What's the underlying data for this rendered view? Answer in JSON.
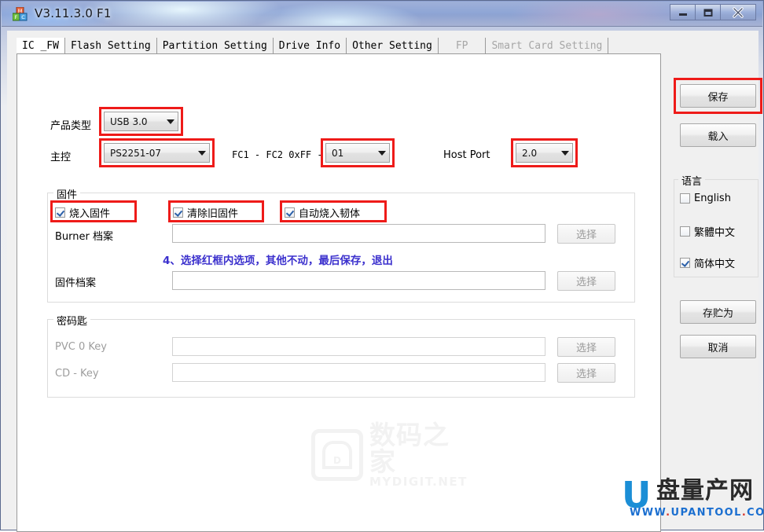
{
  "window": {
    "title": "V3.11.3.0 F1",
    "icon": "mfc-app-icon",
    "controls": {
      "minimize": "minimize-icon",
      "maximize": "maximize-icon",
      "close": "close-icon"
    }
  },
  "tabs": [
    {
      "label": "IC _FW",
      "active": true,
      "disabled": false
    },
    {
      "label": "Flash Setting",
      "active": false,
      "disabled": false
    },
    {
      "label": "Partition Setting",
      "active": false,
      "disabled": false
    },
    {
      "label": "Drive Info",
      "active": false,
      "disabled": false
    },
    {
      "label": "Other Setting",
      "active": false,
      "disabled": false
    },
    {
      "label": "FP",
      "active": false,
      "disabled": true
    },
    {
      "label": "Smart Card Setting",
      "active": false,
      "disabled": true
    }
  ],
  "form": {
    "product_type_label": "产品类型",
    "product_type_value": "USB 3.0",
    "controller_label": "主控",
    "controller_value": "PS2251-07",
    "fc_label": "FC1 - FC2  0xFF -",
    "fc_value": "01",
    "host_port_label": "Host Port",
    "host_port_value": "2.0"
  },
  "firmware": {
    "group_title": "固件",
    "checkboxes": [
      {
        "label": "烧入固件",
        "checked": true
      },
      {
        "label": "清除旧固件",
        "checked": true
      },
      {
        "label": "自动烧入韧体",
        "checked": true
      }
    ],
    "burner_label": "Burner 档案",
    "burner_value": "",
    "burner_button": "选择",
    "firmware_label": "固件档案",
    "firmware_value": "",
    "firmware_button": "选择",
    "note": "4、选择红框内选项，其他不动，最后保存，退出"
  },
  "password": {
    "group_title": "密码匙",
    "rows": [
      {
        "label": "PVC 0 Key",
        "value": "",
        "button": "选择"
      },
      {
        "label": "CD - Key",
        "value": "",
        "button": "选择"
      }
    ]
  },
  "sidebar": {
    "save_button": "保存",
    "load_button": "载入",
    "language_title": "语言",
    "languages": [
      {
        "label": "English",
        "checked": false
      },
      {
        "label": "繁體中文",
        "checked": false
      },
      {
        "label": "简体中文",
        "checked": true
      }
    ],
    "save_as_button": "存贮为",
    "cancel_button": "取消"
  },
  "watermark": {
    "badge_letter": "D",
    "cn": "数码之家",
    "en": "MYDIGIT.NET"
  },
  "logo": {
    "mark": "U",
    "cn": "盘量产网",
    "url_prefix": "WWW",
    "url_dot1": ".",
    "url_name": "UPANTOOL",
    "url_dot2": ".",
    "url_tld": "COM"
  },
  "colors": {
    "highlight_red": "#ee1b19",
    "note_blue": "#3b30cd",
    "logo_blue": "#1b8ed6",
    "accent_check": "#2a5fa8"
  }
}
